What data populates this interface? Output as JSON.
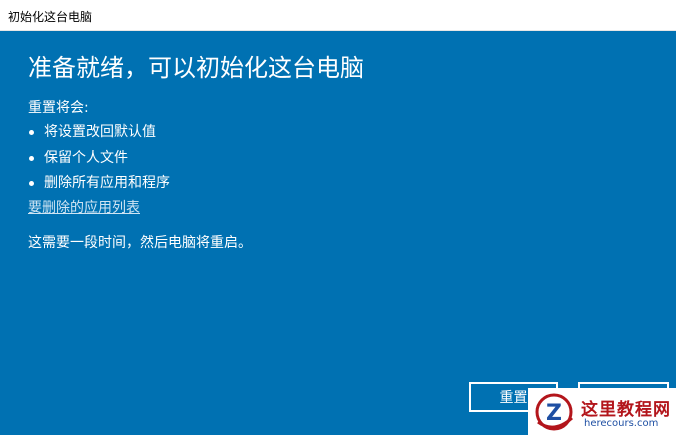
{
  "window": {
    "title": "初始化这台电脑"
  },
  "main": {
    "heading": "准备就绪，可以初始化这台电脑",
    "intro": "重置将会:",
    "items": [
      "将设置改回默认值",
      "保留个人文件",
      "删除所有应用和程序"
    ],
    "link": "要删除的应用列表",
    "note": "这需要一段时间，然后电脑将重启。"
  },
  "buttons": {
    "reset_label": "重置"
  },
  "watermark": {
    "title": "这里教程网",
    "url": "herecours.com",
    "logo_letter": "Z"
  },
  "colors": {
    "accent": "#0071b2",
    "link": "#cfe4f3",
    "watermark_red": "#b3151b",
    "watermark_blue": "#1e4fa3"
  }
}
